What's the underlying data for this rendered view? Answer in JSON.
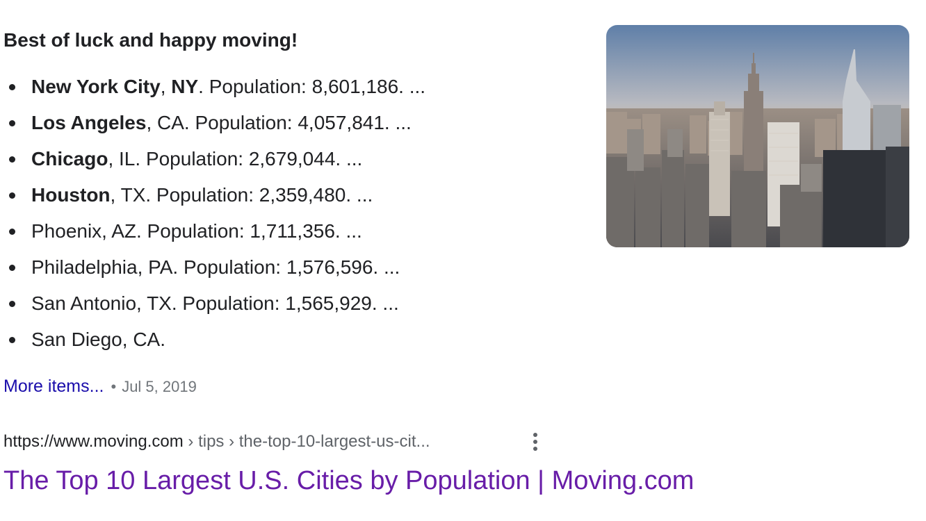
{
  "snippet": {
    "heading": "Best of luck and happy moving!",
    "items": [
      {
        "parts": [
          {
            "text": "New York City",
            "bold": true
          },
          {
            "text": ", ",
            "bold": false
          },
          {
            "text": "NY",
            "bold": true
          },
          {
            "text": ". Population: 8,601,186. ...",
            "bold": false
          }
        ]
      },
      {
        "parts": [
          {
            "text": "Los Angeles",
            "bold": true
          },
          {
            "text": ", CA. Population: 4,057,841. ...",
            "bold": false
          }
        ]
      },
      {
        "parts": [
          {
            "text": "Chicago",
            "bold": true
          },
          {
            "text": ", IL. Population: 2,679,044. ...",
            "bold": false
          }
        ]
      },
      {
        "parts": [
          {
            "text": "Houston",
            "bold": true
          },
          {
            "text": ", TX. Population: 2,359,480. ...",
            "bold": false
          }
        ]
      },
      {
        "parts": [
          {
            "text": "Phoenix, AZ. Population: 1,711,356. ...",
            "bold": false
          }
        ]
      },
      {
        "parts": [
          {
            "text": "Philadelphia, PA. Population: 1,576,596. ...",
            "bold": false
          }
        ]
      },
      {
        "parts": [
          {
            "text": "San Antonio, TX. Population: 1,565,929. ...",
            "bold": false
          }
        ]
      },
      {
        "parts": [
          {
            "text": "San Diego, CA.",
            "bold": false
          }
        ]
      }
    ],
    "more_label": "More items...",
    "separator": "•",
    "date": "Jul 5, 2019",
    "image_icon": "city-skyline-photo"
  },
  "result": {
    "url_host": "https://www.moving.com",
    "url_path": " › tips › the-top-10-largest-us-cit...",
    "menu_icon": "more-vert-icon",
    "title": "The Top 10 Largest U.S. Cities by Population | Moving.com"
  },
  "colors": {
    "link": "#1a0dab",
    "visited": "#681da8",
    "text": "#202124",
    "muted": "#70757a"
  }
}
